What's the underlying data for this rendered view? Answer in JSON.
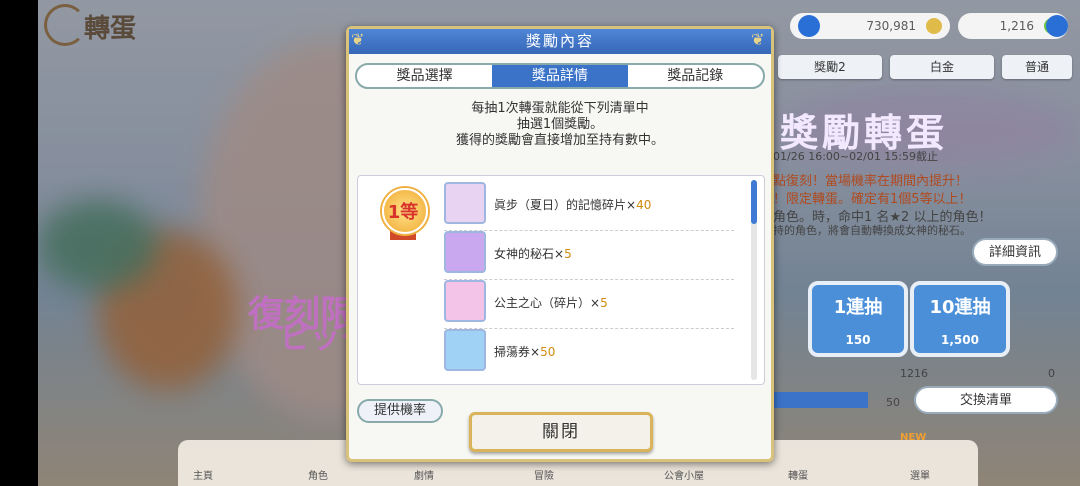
{
  "background": {
    "title": "轉蛋",
    "resources": [
      {
        "value": "730,981",
        "icon": "coin-icon"
      },
      {
        "value": "1,216",
        "icon": "jewel-icon"
      }
    ],
    "tabs": [
      "獎勵2",
      "白金",
      "普通"
    ],
    "banner_title": "獎勵轉蛋",
    "banner_date": "01/26 16:00~02/01 15:59截止",
    "info_lines": [
      "點復刻！當場機率在期間內提升！",
      "！限定轉蛋。確定有1個5等以上！",
      "角色。時，命中1 名★2 以上的角色！",
      "持的角色，將會自動轉換成女神的秘石。"
    ],
    "detail_button": "詳細資訊",
    "draw_1": {
      "label": "1連抽",
      "cost": "150"
    },
    "draw_10": {
      "label": "10連抽",
      "cost": "1,500"
    },
    "stock_value": "1216",
    "stock_zero": "0",
    "gauge_value": "50",
    "exchange_button": "交換清單",
    "left_logo_line1": "復刻限",
    "left_logo_line2": "ピックア",
    "nav": [
      "主頁",
      "角色",
      "劇情",
      "冒險",
      "公會小屋",
      "轉蛋",
      "選單"
    ],
    "nav_new_badge": "NEW"
  },
  "dialog": {
    "title": "獎勵內容",
    "tabs": [
      {
        "label": "獎品選擇",
        "active": false
      },
      {
        "label": "獎品詳情",
        "active": true
      },
      {
        "label": "獎品記錄",
        "active": false
      }
    ],
    "description": [
      "每抽1次轉蛋就能從下列清單中",
      "抽選1個獎勵。",
      "獲得的獎勵會直接增加至持有數中。"
    ],
    "rank_label": "1等",
    "items": [
      {
        "name": "眞步（夏日）的記憶碎片",
        "times": "×",
        "qty": "40",
        "icon": "memory-shard-icon",
        "color": "#e9d3f3"
      },
      {
        "name": "女神的秘石",
        "times": "×",
        "qty": "5",
        "icon": "divine-amulet-icon",
        "color": "#c9a8f0"
      },
      {
        "name": "公主之心（碎片）",
        "times": "×",
        "qty": "5",
        "icon": "princess-heart-icon",
        "color": "#f4c4e8"
      },
      {
        "name": "掃蕩券",
        "times": "×",
        "qty": "50",
        "icon": "sweep-ticket-icon",
        "color": "#9fd2f4"
      }
    ],
    "odds_button": "提供機率",
    "close_button": "關閉"
  }
}
